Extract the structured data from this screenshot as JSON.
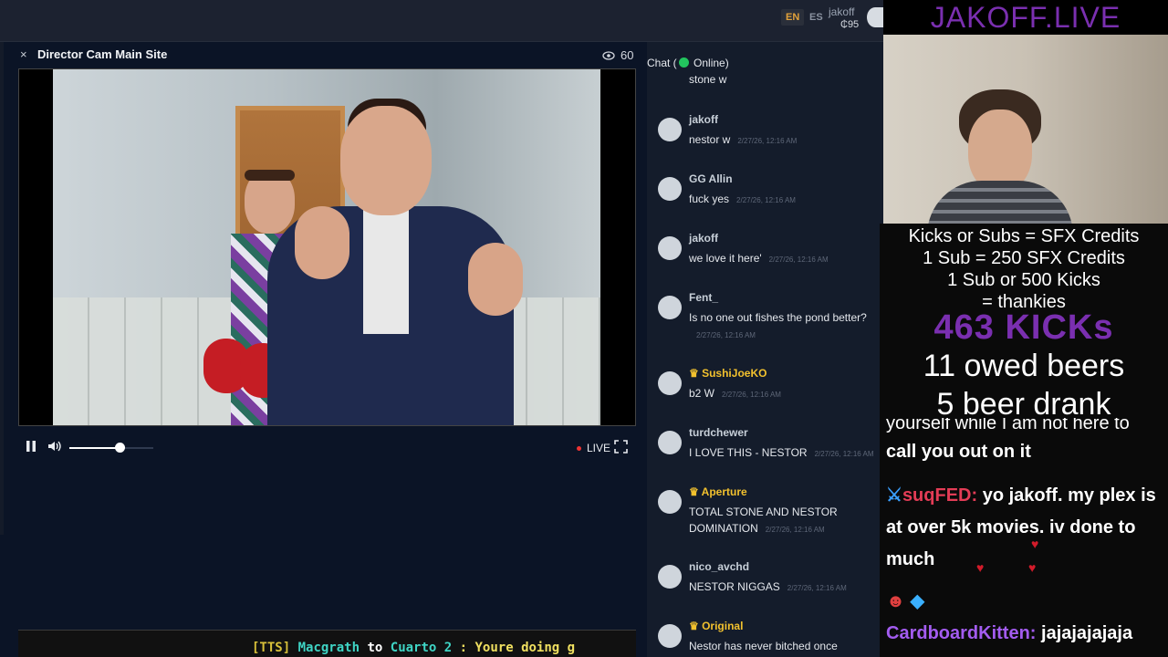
{
  "topbar": {
    "lang_en": "EN",
    "lang_es": "ES",
    "username": "jakoff",
    "balance": "₵95"
  },
  "player": {
    "close": "×",
    "title": "Director Cam Main Site",
    "viewers": "60",
    "live_label": "LIVE",
    "volume_level": 0.6
  },
  "tts": {
    "tag": "[TTS]",
    "from": "Macgrath",
    "to_word": "to",
    "target": "Cuarto 2",
    "message": ": Youre doing g"
  },
  "chat": {
    "header_prefix": "Chat (",
    "header_status": "Online)",
    "top_partial": "stone w",
    "messages": [
      {
        "user": "jakoff",
        "text": "nestor w",
        "time": "2/27/26, 12:16 AM",
        "crown": false
      },
      {
        "user": "GG Allin",
        "text": "fuck yes",
        "time": "2/27/26, 12:16 AM",
        "crown": false
      },
      {
        "user": "jakoff",
        "text": "we love it here'",
        "time": "2/27/26, 12:16 AM",
        "crown": false
      },
      {
        "user": "Fent_",
        "text": "Is no one out fishes the pond better?",
        "time": "2/27/26, 12:16 AM",
        "crown": false
      },
      {
        "user": "SushiJoeKO",
        "text": "b2 W",
        "time": "2/27/26, 12:16 AM",
        "crown": true
      },
      {
        "user": "turdchewer",
        "text": "I LOVE THIS - NESTOR",
        "time": "2/27/26, 12:16 AM",
        "crown": false
      },
      {
        "user": "Aperture",
        "text": "TOTAL STONE AND NESTOR DOMINATION",
        "time": "2/27/26, 12:16 AM",
        "crown": true
      },
      {
        "user": "nico_avchd",
        "text": "NESTOR NIGGAS",
        "time": "2/27/26, 12:16 AM",
        "crown": false
      },
      {
        "user": "Original",
        "text": "Nestor has never bitched once",
        "time": "",
        "crown": true
      }
    ]
  },
  "stream_overlay": {
    "title": "JAKOFF.LIVE",
    "line1": "Kicks or Subs = SFX Credits",
    "line2": "1 Sub = 250 SFX Credits",
    "line3": "1 Sub or 500 Kicks",
    "line4": "= thankies",
    "kicks": "463 KICKs",
    "beers_owed": "11 owed beers",
    "beers_drank": "5 beer drank",
    "chat_partial_1": "yourself while I am not here to",
    "chat_partial_2": "call you out on it",
    "chat2_user": "suqFED:",
    "chat2_text": "yo jakoff. my plex is at over 5k movies. iv done to much",
    "chat3_user": "CardboardKitten:",
    "chat3_text": "jajajajajaja"
  },
  "colors": {
    "accent_gold": "#f2c12e",
    "live_red": "#e33333",
    "online_green": "#22c55e",
    "overlay_purple": "#7a2fb0"
  }
}
